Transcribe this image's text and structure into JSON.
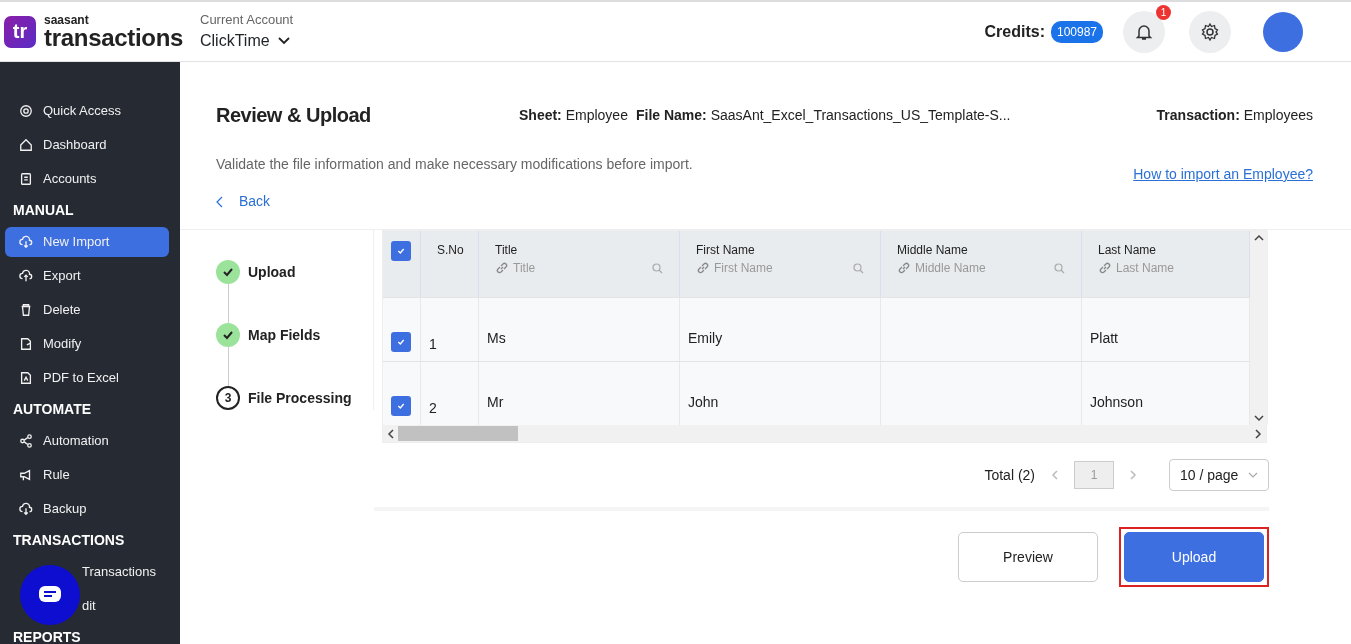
{
  "header": {
    "logo_mark": "tr",
    "brand_small": "saasant",
    "brand": "transactions",
    "account_label": "Current Account",
    "account": "ClickTime",
    "credits_label": "Credits:",
    "credits": "100987",
    "notifications": "1"
  },
  "sidebar": {
    "sections": [
      {
        "items": [
          {
            "label": "Quick Access",
            "selected": false
          },
          {
            "label": "Dashboard",
            "selected": false
          },
          {
            "label": "Accounts",
            "selected": false
          }
        ]
      },
      {
        "title": "MANUAL",
        "items": [
          {
            "label": "New Import",
            "selected": true
          },
          {
            "label": "Export",
            "selected": false
          },
          {
            "label": "Delete",
            "selected": false
          },
          {
            "label": "Modify",
            "selected": false
          },
          {
            "label": "PDF to Excel",
            "selected": false
          }
        ]
      },
      {
        "title": "AUTOMATE",
        "items": [
          {
            "label": "Automation",
            "selected": false
          },
          {
            "label": "Rule",
            "selected": false
          },
          {
            "label": "Backup",
            "selected": false
          }
        ]
      },
      {
        "title": "TRANSACTIONS",
        "items": [
          {
            "label": "Transactions",
            "selected": false,
            "kind": "covered"
          },
          {
            "label": "dit",
            "selected": false,
            "kind": "covered"
          }
        ]
      },
      {
        "title": "REPORTS"
      }
    ]
  },
  "page": {
    "title": "Review & Upload",
    "sheet_label": "Sheet:",
    "sheet": "Employee",
    "file_label": "File Name:",
    "file": "SaasAnt_Excel_Transactions_US_Template-S...",
    "transaction_label": "Transaction:",
    "transaction": "Employees",
    "description": "Validate the file information and make necessary modifications before import.",
    "help_link": "How to import an Employee?",
    "back": "Back"
  },
  "steps": [
    {
      "label": "Upload",
      "done": true
    },
    {
      "label": "Map Fields",
      "done": true
    },
    {
      "label": "File Processing",
      "done": false,
      "number": "3"
    }
  ],
  "table": {
    "all_checked": true,
    "columns": [
      {
        "label": "S.No"
      },
      {
        "label": "Title",
        "placeholder": "Title"
      },
      {
        "label": "First Name",
        "placeholder": "First Name"
      },
      {
        "label": "Middle Name",
        "placeholder": "Middle Name"
      },
      {
        "label": "Last Name",
        "placeholder": "Last Name"
      }
    ],
    "rows": [
      {
        "checked": true,
        "cells": [
          "1",
          "Ms",
          "Emily",
          "",
          "Platt"
        ]
      },
      {
        "checked": true,
        "cells": [
          "2",
          "Mr",
          "John",
          "",
          "Johnson"
        ]
      }
    ]
  },
  "pagination": {
    "total": "Total (2)",
    "page": "1",
    "page_size": "10 / page"
  },
  "buttons": [
    {
      "label": "Preview",
      "kind": "secondary",
      "highlighted": false
    },
    {
      "label": "Upload",
      "kind": "primary",
      "highlighted": true
    }
  ]
}
